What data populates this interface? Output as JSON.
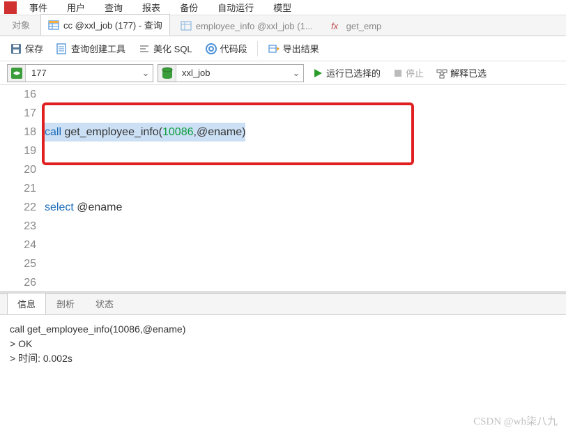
{
  "menu": {
    "items": [
      "事件",
      "用户",
      "查询",
      "报表",
      "备份",
      "自动运行",
      "模型"
    ]
  },
  "tabs": {
    "label_objects": "对象",
    "active_tab": "cc @xxl_job (177) - 查询",
    "inactive_tab1": "employee_info @xxl_job (1...",
    "inactive_tab2": "get_emp"
  },
  "toolbar": {
    "save": "保存",
    "query_tool": "查询创建工具",
    "beautify": "美化 SQL",
    "snippet": "代码段",
    "export": "导出结果"
  },
  "selectors": {
    "connection": "177",
    "database": "xxl_job",
    "run": "运行已选择的",
    "stop": "停止",
    "explain": "解释已选"
  },
  "editor": {
    "line_start": 16,
    "lines": [
      "",
      "",
      "call get_employee_info(10086,@ename)",
      "",
      "",
      "",
      "select @ename",
      "",
      "",
      "",
      ""
    ],
    "code_call": "call",
    "code_func": " get_employee_info(",
    "code_num": "10086",
    "code_rest1": ",@ename)",
    "code_select": "select",
    "code_var": " @ename"
  },
  "result_tabs": {
    "info": "信息",
    "profile": "剖析",
    "status": "状态"
  },
  "result": {
    "line1": "call get_employee_info(10086,@ename)",
    "line2": "> OK",
    "line3": "> 时间: 0.002s"
  },
  "watermark": "CSDN @wh柒八九"
}
